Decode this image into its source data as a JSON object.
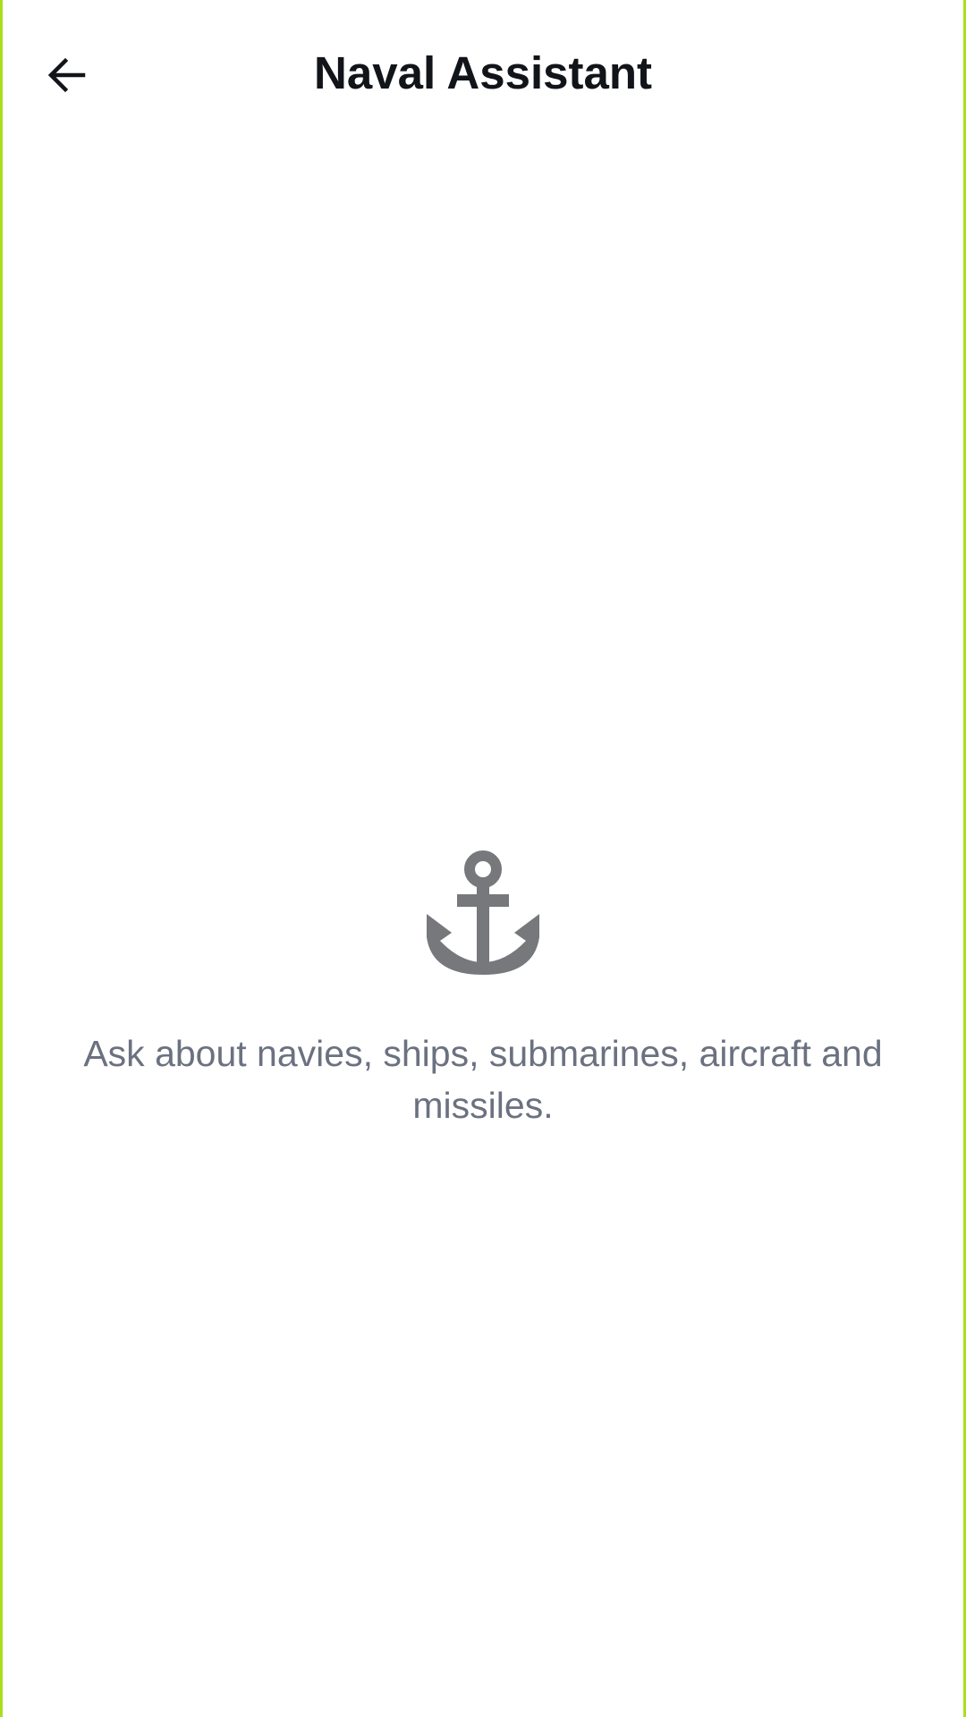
{
  "app_bar": {
    "title": "Naval Assistant",
    "back_icon": "arrow-left-icon"
  },
  "empty_state": {
    "icon": "anchor-icon",
    "message": "Ask about navies, ships, submarines, aircraft and missiles."
  },
  "colors": {
    "frame_border": "#a9de1f",
    "background": "#ffffff",
    "title_text": "#111418",
    "icon": "#76787c",
    "message_text": "#6b7180"
  }
}
